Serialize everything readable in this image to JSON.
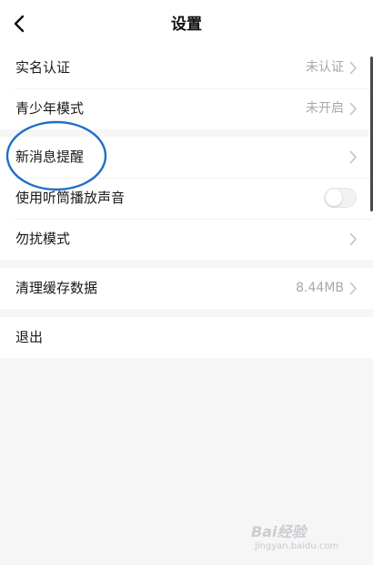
{
  "header": {
    "title": "设置",
    "back_icon": "chevron-left-icon"
  },
  "groups": [
    {
      "items": [
        {
          "label": "实名认证",
          "value": "未认证",
          "control": "chevron"
        },
        {
          "label": "青少年模式",
          "value": "未开启",
          "control": "chevron"
        }
      ]
    },
    {
      "items": [
        {
          "label": "新消息提醒",
          "value": "",
          "control": "chevron"
        },
        {
          "label": "使用听筒播放声音",
          "value": "",
          "control": "toggle",
          "toggle_on": false
        },
        {
          "label": "勿扰模式",
          "value": "",
          "control": "chevron"
        }
      ]
    },
    {
      "items": [
        {
          "label": "清理缓存数据",
          "value": "8.44MB",
          "control": "chevron"
        }
      ]
    },
    {
      "items": [
        {
          "label": "退出",
          "value": "",
          "control": "none"
        }
      ]
    }
  ],
  "annotation": {
    "shape": "ellipse",
    "color": "#1f6fc5",
    "target": "新消息提醒"
  },
  "watermark": {
    "logo": "Bai经验",
    "url": "jingyan.baidu.com"
  },
  "colors": {
    "background": "#f6f6f7",
    "surface": "#ffffff",
    "text": "#1a1a1a",
    "secondary_text": "#a8a8a8",
    "annotation": "#1f6fc5"
  }
}
